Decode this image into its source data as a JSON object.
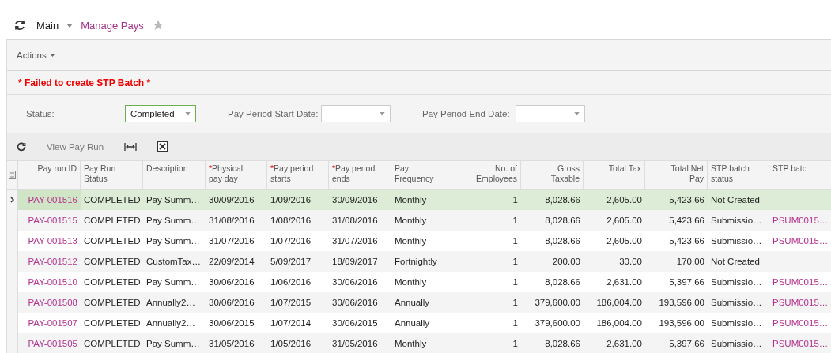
{
  "breadcrumb": {
    "parent": "Main",
    "title": "Manage Pays",
    "favorite": false
  },
  "toolbar": {
    "actions": "Actions"
  },
  "error_message": "* Failed to create STP Batch *",
  "filters": [
    {
      "label": "Status:",
      "value": "Completed",
      "highlighted": true
    },
    {
      "label": "Pay Period Start Date:",
      "highlighted": false
    },
    {
      "label": "Pay Period End Date:",
      "highlighted": false
    }
  ],
  "grid_toolbar": {
    "view_button": "View Pay Run"
  },
  "table": {
    "columns": [
      {
        "label": "Pay run ID"
      },
      {
        "label": "Pay Run\nStatus"
      },
      {
        "label": "Description"
      },
      {
        "label": "Physical\npay day",
        "required_mark": "*"
      },
      {
        "label": "Pay period\nstarts",
        "required_mark": "*"
      },
      {
        "label": "Pay period\nends",
        "required_mark": "*"
      },
      {
        "label": "Pay\nFrequency"
      },
      {
        "label": "No. of\nEmployees"
      },
      {
        "label": "Gross\nTaxable"
      },
      {
        "label": "Total Tax"
      },
      {
        "label": "Total Net\nPay"
      },
      {
        "label": "STP batch\nstatus"
      },
      {
        "label": "STP batc"
      }
    ],
    "rows": [
      {
        "selected": true,
        "cells": [
          "PAY-001516",
          "COMPLETED",
          "Pay Summ…",
          "30/09/2016",
          "1/09/2016",
          "30/09/2016",
          "Monthly",
          "1",
          "8,028.66",
          "2,605.00",
          "5,423.66",
          "Not Created",
          null
        ]
      },
      {
        "selected": false,
        "cells": [
          "PAY-001515",
          "COMPLETED",
          "Pay Summ…",
          "31/08/2016",
          "1/08/2016",
          "31/08/2016",
          "Monthly",
          "1",
          "8,028.66",
          "2,605.00",
          "5,423.66",
          "Submissio…",
          "PSUM0015…"
        ]
      },
      {
        "selected": false,
        "cells": [
          "PAY-001513",
          "COMPLETED",
          "Pay Summ…",
          "31/07/2016",
          "1/07/2016",
          "31/07/2016",
          "Monthly",
          "1",
          "8,028.66",
          "2,605.00",
          "5,423.66",
          "Submissio…",
          "PSUM0015…"
        ]
      },
      {
        "selected": false,
        "cells": [
          "PAY-001512",
          "COMPLETED",
          "CustomTax…",
          "22/09/2014",
          "5/09/2017",
          "18/09/2017",
          "Fortnightly",
          "1",
          "200.00",
          "30.00",
          "170.00",
          "Not Created",
          null
        ]
      },
      {
        "selected": false,
        "cells": [
          "PAY-001510",
          "COMPLETED",
          "Pay Summ…",
          "30/06/2016",
          "1/06/2016",
          "30/06/2016",
          "Monthly",
          "1",
          "8,028.66",
          "2,631.00",
          "5,397.66",
          "Submissio…",
          "PSUM0015…"
        ]
      },
      {
        "selected": false,
        "cells": [
          "PAY-001508",
          "COMPLETED",
          "Annually2…",
          "30/06/2016",
          "1/07/2015",
          "30/06/2016",
          "Annually",
          "1",
          "379,600.00",
          "186,004.00",
          "193,596.00",
          "Submissio…",
          "PSUM0015…"
        ]
      },
      {
        "selected": false,
        "cells": [
          "PAY-001507",
          "COMPLETED",
          "Annually2…",
          "30/06/2015",
          "1/07/2014",
          "30/06/2015",
          "Annually",
          "1",
          "379,600.00",
          "186,004.00",
          "193,596.00",
          "Submissio…",
          "PSUM0015…"
        ]
      },
      {
        "selected": false,
        "cells": [
          "PAY-001505",
          "COMPLETED",
          "Pay Summ…",
          "31/05/2016",
          "1/05/2016",
          "31/05/2016",
          "Monthly",
          "1",
          "8,028.66",
          "2,631.00",
          "5,397.66",
          "Submissio…",
          "PSUM0015…"
        ]
      }
    ]
  }
}
